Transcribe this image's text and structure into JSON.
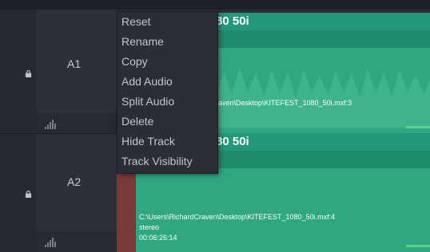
{
  "tracks": [
    {
      "name": "A1",
      "clip_title": "80 50i",
      "clip_path": "raven\\Desktop\\KITEFEST_1080_50i.mxf:3"
    },
    {
      "name": "A2",
      "clip_title": "80 50i",
      "clip_path": "C:\\Users\\RichardCraven\\Desktop\\KITEFEST_1080_50i.mxf:4",
      "clip_channel": "stereo",
      "clip_duration": "00:06:26:14"
    }
  ],
  "context_menu": {
    "items": [
      "Reset",
      "Rename",
      "Copy",
      "Add Audio",
      "Split Audio",
      "Delete",
      "Hide Track",
      "Track Visibility"
    ]
  },
  "colors": {
    "clip": "#2fa882",
    "clip_header": "#23997a",
    "menu_bg": "#2b2f35",
    "mute_strip": "#7a3a3a",
    "level_indicator": "#5fd08b"
  },
  "icons": [
    "lock-icon",
    "audio-meter-icon"
  ]
}
